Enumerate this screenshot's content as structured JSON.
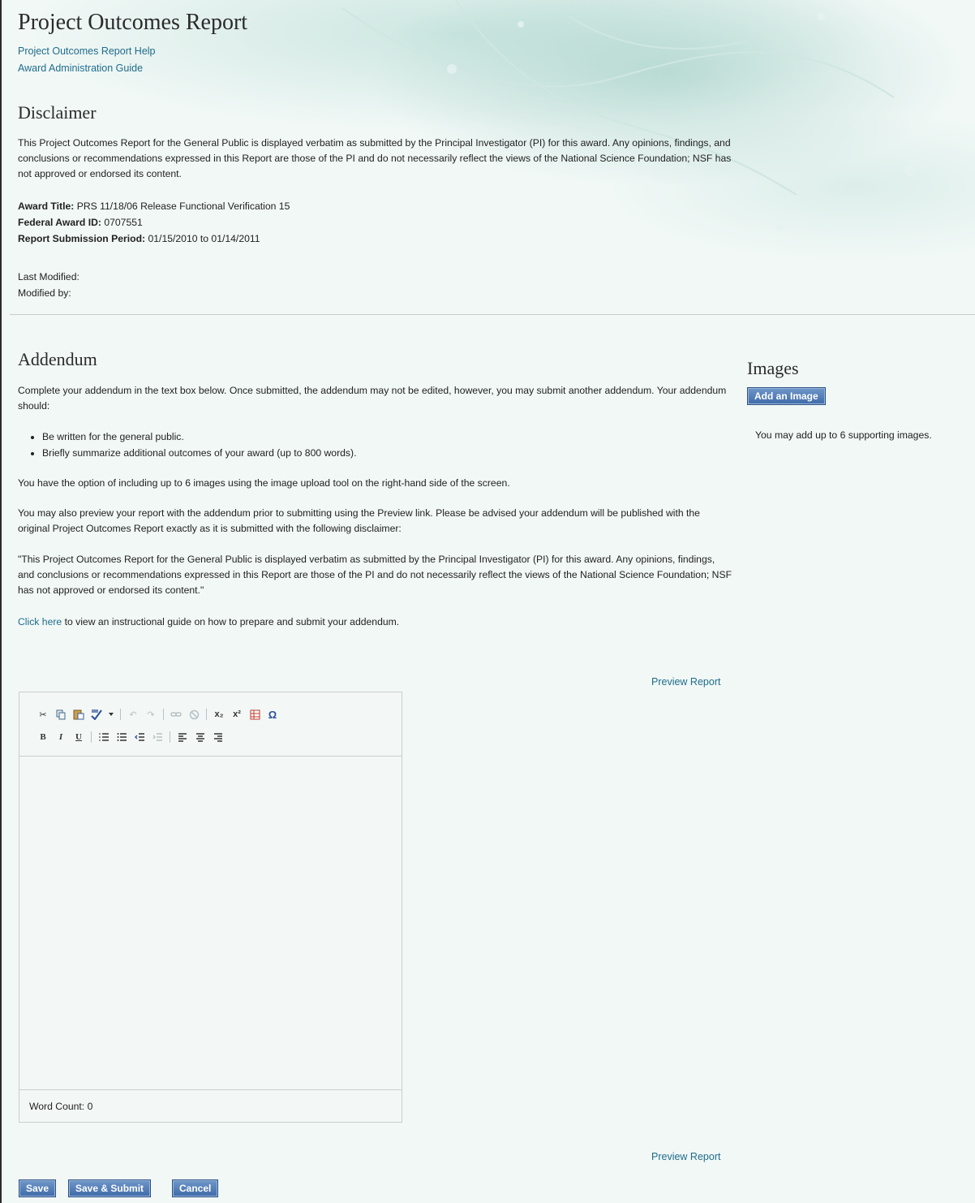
{
  "header": {
    "title": "Project Outcomes Report",
    "links": [
      "Project Outcomes Report Help",
      "Award Administration Guide"
    ]
  },
  "disclaimer": {
    "heading": "Disclaimer",
    "text": "This Project Outcomes Report for the General Public is displayed verbatim as submitted by the Principal Investigator (PI) for this award. Any opinions, findings, and conclusions or recommendations expressed in this Report are those of the PI and do not necessarily reflect the views of the National Science Foundation; NSF has not approved or endorsed its content.",
    "award_title_label": "Award Title:",
    "award_title_value": "PRS 11/18/06 Release Functional Verification 15",
    "federal_award_label": "Federal Award ID:",
    "federal_award_value": "0707551",
    "period_label": "Report Submission Period:",
    "period_value": "01/15/2010 to 01/14/2011",
    "last_modified_label": "Last Modified:",
    "modified_by_label": "Modified by:"
  },
  "addendum": {
    "heading": "Addendum",
    "intro": "Complete your addendum in the text box below.  Once submitted, the addendum may not be edited, however, you may submit another addendum.  Your addendum should:",
    "bullets": [
      "Be written for the general public.",
      "Briefly summarize additional outcomes of your award (up to 800 words)."
    ],
    "images_note": "You have the option of including up to 6 images using the image upload tool on the right-hand side of the screen.",
    "preview_note": "You may also preview your report with the addendum prior to submitting using the Preview link.  Please be advised your addendum will be published with the original Project Outcomes Report exactly as it is submitted with the following disclaimer:",
    "quote": "\"This Project Outcomes Report for the General Public is displayed verbatim as submitted by the Principal Investigator (PI) for this award. Any opinions, findings, and conclusions or recommendations expressed in this Report are those of the PI and do not necessarily reflect the views of the National Science Foundation; NSF has not approved or endorsed its content.\"",
    "click_here": "Click here",
    "click_here_rest": " to view an instructional guide on how to prepare and submit your addendum.",
    "preview_link": "Preview Report"
  },
  "images_panel": {
    "heading": "Images",
    "add_button": "Add an Image",
    "note": "You may add up to 6 supporting images."
  },
  "editor": {
    "word_count": "Word Count: 0",
    "toolbar_row1": [
      "cut-icon",
      "copy-icon",
      "paste-word-icon",
      "spellcheck-icon",
      "dropdown-arrow-icon",
      "undo-icon",
      "redo-icon",
      "link-icon",
      "unlink-icon",
      "subscript-icon",
      "superscript-icon",
      "table-icon",
      "special-char-icon"
    ],
    "toolbar_row2": [
      "bold-icon",
      "italic-icon",
      "underline-icon",
      "ordered-list-icon",
      "unordered-list-icon",
      "outdent-icon",
      "indent-icon",
      "align-left-icon",
      "align-center-icon",
      "align-right-icon"
    ],
    "glyphs": {
      "cut": "✂",
      "subscript": "x₂",
      "superscript": "x²",
      "omega": "Ω",
      "bold": "B",
      "italic": "I",
      "underline": "U"
    }
  },
  "footer": {
    "preview_link": "Preview Report",
    "buttons": [
      "Save",
      "Save & Submit",
      "Cancel"
    ]
  },
  "colors": {
    "link": "#1f6c8c",
    "button": "#4a74b0",
    "background": "#f1f8f6"
  }
}
